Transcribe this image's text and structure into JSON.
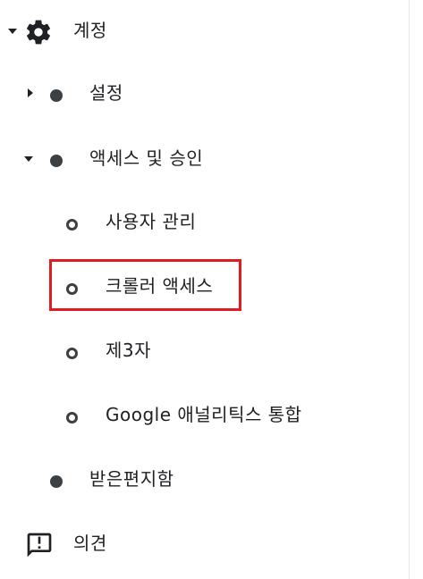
{
  "nav": {
    "account": {
      "label": "계정",
      "icon": "gear-icon",
      "expanded": true
    },
    "settings": {
      "label": "설정",
      "expanded": false
    },
    "access": {
      "label": "액세스 및 승인",
      "expanded": true
    },
    "access_items": [
      {
        "label": "사용자 관리"
      },
      {
        "label": "크롤러 액세스",
        "highlighted": true
      },
      {
        "label": "제3자"
      },
      {
        "label": "Google 애널리틱스 통합"
      }
    ],
    "inbox": {
      "label": "받은편지함"
    },
    "feedback": {
      "label": "의견",
      "icon": "feedback-icon"
    }
  },
  "colors": {
    "text": "#202124",
    "icon": "#3c4043",
    "highlight": "#e11b22"
  }
}
